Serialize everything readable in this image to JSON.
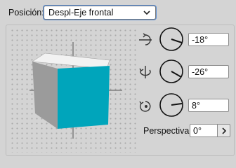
{
  "position": {
    "label": "Posición:",
    "selected": "Despl-Eje frontal"
  },
  "rotation": {
    "x": {
      "value": "-18°",
      "icon": "rotate-x-axis-icon"
    },
    "y": {
      "value": "-26°",
      "icon": "rotate-y-axis-icon"
    },
    "z": {
      "value": "8°",
      "icon": "rotate-z-axis-icon"
    }
  },
  "perspective": {
    "label": "Perspectiva:",
    "value": "0°"
  },
  "colors": {
    "cube_front": "#00a5bb",
    "cube_top": "#f2f2f2",
    "cube_side": "#9b9b9b",
    "focus_ring": "#5b8fd6"
  }
}
